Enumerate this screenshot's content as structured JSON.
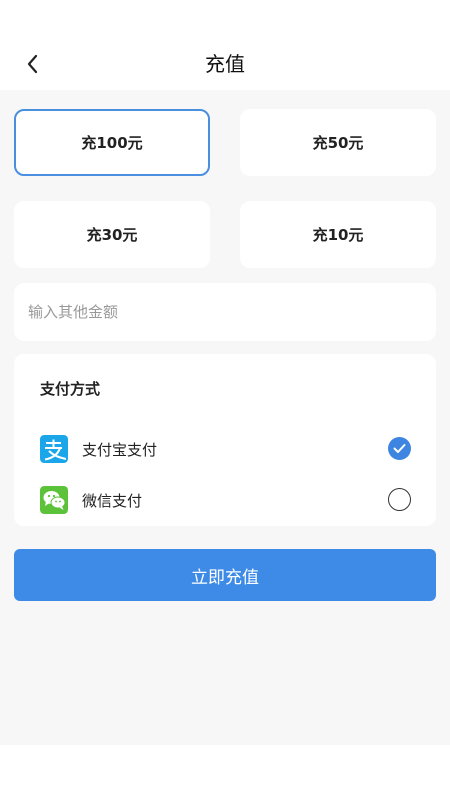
{
  "header": {
    "title": "充值",
    "back_icon": "chevron-left-icon"
  },
  "amounts": [
    {
      "label": "充100元",
      "selected": true
    },
    {
      "label": "充50元",
      "selected": false
    },
    {
      "label": "充30元",
      "selected": false
    },
    {
      "label": "充10元",
      "selected": false
    }
  ],
  "custom_amount": {
    "placeholder": "输入其他金额",
    "value": ""
  },
  "payment": {
    "title": "支付方式",
    "methods": [
      {
        "label": "支付宝支付",
        "icon": "alipay-icon",
        "selected": true
      },
      {
        "label": "微信支付",
        "icon": "wechat-icon",
        "selected": false
      }
    ]
  },
  "submit_label": "立即充值",
  "colors": {
    "accent": "#3d8be6",
    "alipay": "#1aa6e8",
    "wechat": "#5cc23a",
    "background": "#f7f7f7"
  }
}
